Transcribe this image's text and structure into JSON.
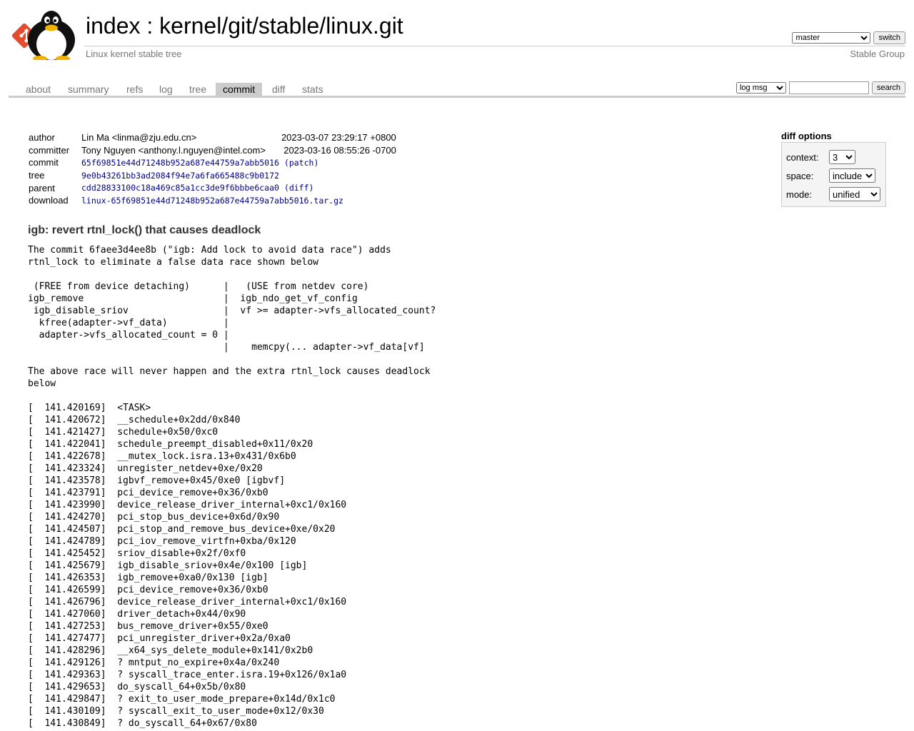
{
  "header": {
    "index_label": "index",
    "separator": ":",
    "repo_path": "kernel/git/stable/linux.git",
    "description": "Linux kernel stable tree",
    "owner": "Stable Group",
    "branch_selected": "master",
    "branch_options": [
      "master"
    ],
    "switch_label": "switch"
  },
  "tabs": [
    {
      "label": "about"
    },
    {
      "label": "summary"
    },
    {
      "label": "refs"
    },
    {
      "label": "log"
    },
    {
      "label": "tree"
    },
    {
      "label": "commit"
    },
    {
      "label": "diff"
    },
    {
      "label": "stats"
    }
  ],
  "active_tab": "commit",
  "search": {
    "mode_selected": "log msg",
    "mode_options": [
      "log msg"
    ],
    "query": "",
    "button_label": "search"
  },
  "commit": {
    "author_label": "author",
    "author": "Lin Ma <linma@zju.edu.cn>",
    "author_date": "2023-03-07 23:29:17 +0800",
    "committer_label": "committer",
    "committer": "Tony Nguyen <anthony.l.nguyen@intel.com>",
    "committer_date": "2023-03-16 08:55:26 -0700",
    "commit_label": "commit",
    "commit_hash": "65f69851e44d71248b952a687e44759a7abb5016",
    "patch_open": "(",
    "patch_label": "patch",
    "patch_close": ")",
    "tree_label": "tree",
    "tree_hash": "9e0b43261bb3ad2084f94e7a6fa665488c9b0172",
    "parent_label": "parent",
    "parent_hash": "cdd28833100c18a469c85a1cc3de9f6bbbe6caa0",
    "diff_open": "(",
    "diff_label": "diff",
    "diff_close": ")",
    "download_label": "download",
    "download_file": "linux-65f69851e44d71248b952a687e44759a7abb5016.tar.gz"
  },
  "diff_options": {
    "title": "diff options",
    "context_label": "context:",
    "context_value": "3",
    "space_label": "space:",
    "space_value": "include",
    "mode_label": "mode:",
    "mode_value": "unified"
  },
  "message": {
    "subject": "igb: revert rtnl_lock() that causes deadlock",
    "body": "The commit 6faee3d4ee8b (\"igb: Add lock to avoid data race\") adds\nrtnl_lock to eliminate a false data race shown below\n\n (FREE from device detaching)      |   (USE from netdev core)\nigb_remove                         |  igb_ndo_get_vf_config\n igb_disable_sriov                 |  vf >= adapter->vfs_allocated_count?\n  kfree(adapter->vf_data)          |\n  adapter->vfs_allocated_count = 0 |\n                                   |    memcpy(... adapter->vf_data[vf]\n\nThe above race will never happen and the extra rtnl_lock causes deadlock\nbelow\n\n[  141.420169]  <TASK>\n[  141.420672]  __schedule+0x2dd/0x840\n[  141.421427]  schedule+0x50/0xc0\n[  141.422041]  schedule_preempt_disabled+0x11/0x20\n[  141.422678]  __mutex_lock.isra.13+0x431/0x6b0\n[  141.423324]  unregister_netdev+0xe/0x20\n[  141.423578]  igbvf_remove+0x45/0xe0 [igbvf]\n[  141.423791]  pci_device_remove+0x36/0xb0\n[  141.423990]  device_release_driver_internal+0xc1/0x160\n[  141.424270]  pci_stop_bus_device+0x6d/0x90\n[  141.424507]  pci_stop_and_remove_bus_device+0xe/0x20\n[  141.424789]  pci_iov_remove_virtfn+0xba/0x120\n[  141.425452]  sriov_disable+0x2f/0xf0\n[  141.425679]  igb_disable_sriov+0x4e/0x100 [igb]\n[  141.426353]  igb_remove+0xa0/0x130 [igb]\n[  141.426599]  pci_device_remove+0x36/0xb0\n[  141.426796]  device_release_driver_internal+0xc1/0x160\n[  141.427060]  driver_detach+0x44/0x90\n[  141.427253]  bus_remove_driver+0x55/0xe0\n[  141.427477]  pci_unregister_driver+0x2a/0xa0\n[  141.428296]  __x64_sys_delete_module+0x141/0x2b0\n[  141.429126]  ? mntput_no_expire+0x4a/0x240\n[  141.429363]  ? syscall_trace_enter.isra.19+0x126/0x1a0\n[  141.429653]  do_syscall_64+0x5b/0x80\n[  141.429847]  ? exit_to_user_mode_prepare+0x14d/0x1c0\n[  141.430109]  ? syscall_exit_to_user_mode+0x12/0x30\n[  141.430849]  ? do_syscall_64+0x67/0x80"
  }
}
